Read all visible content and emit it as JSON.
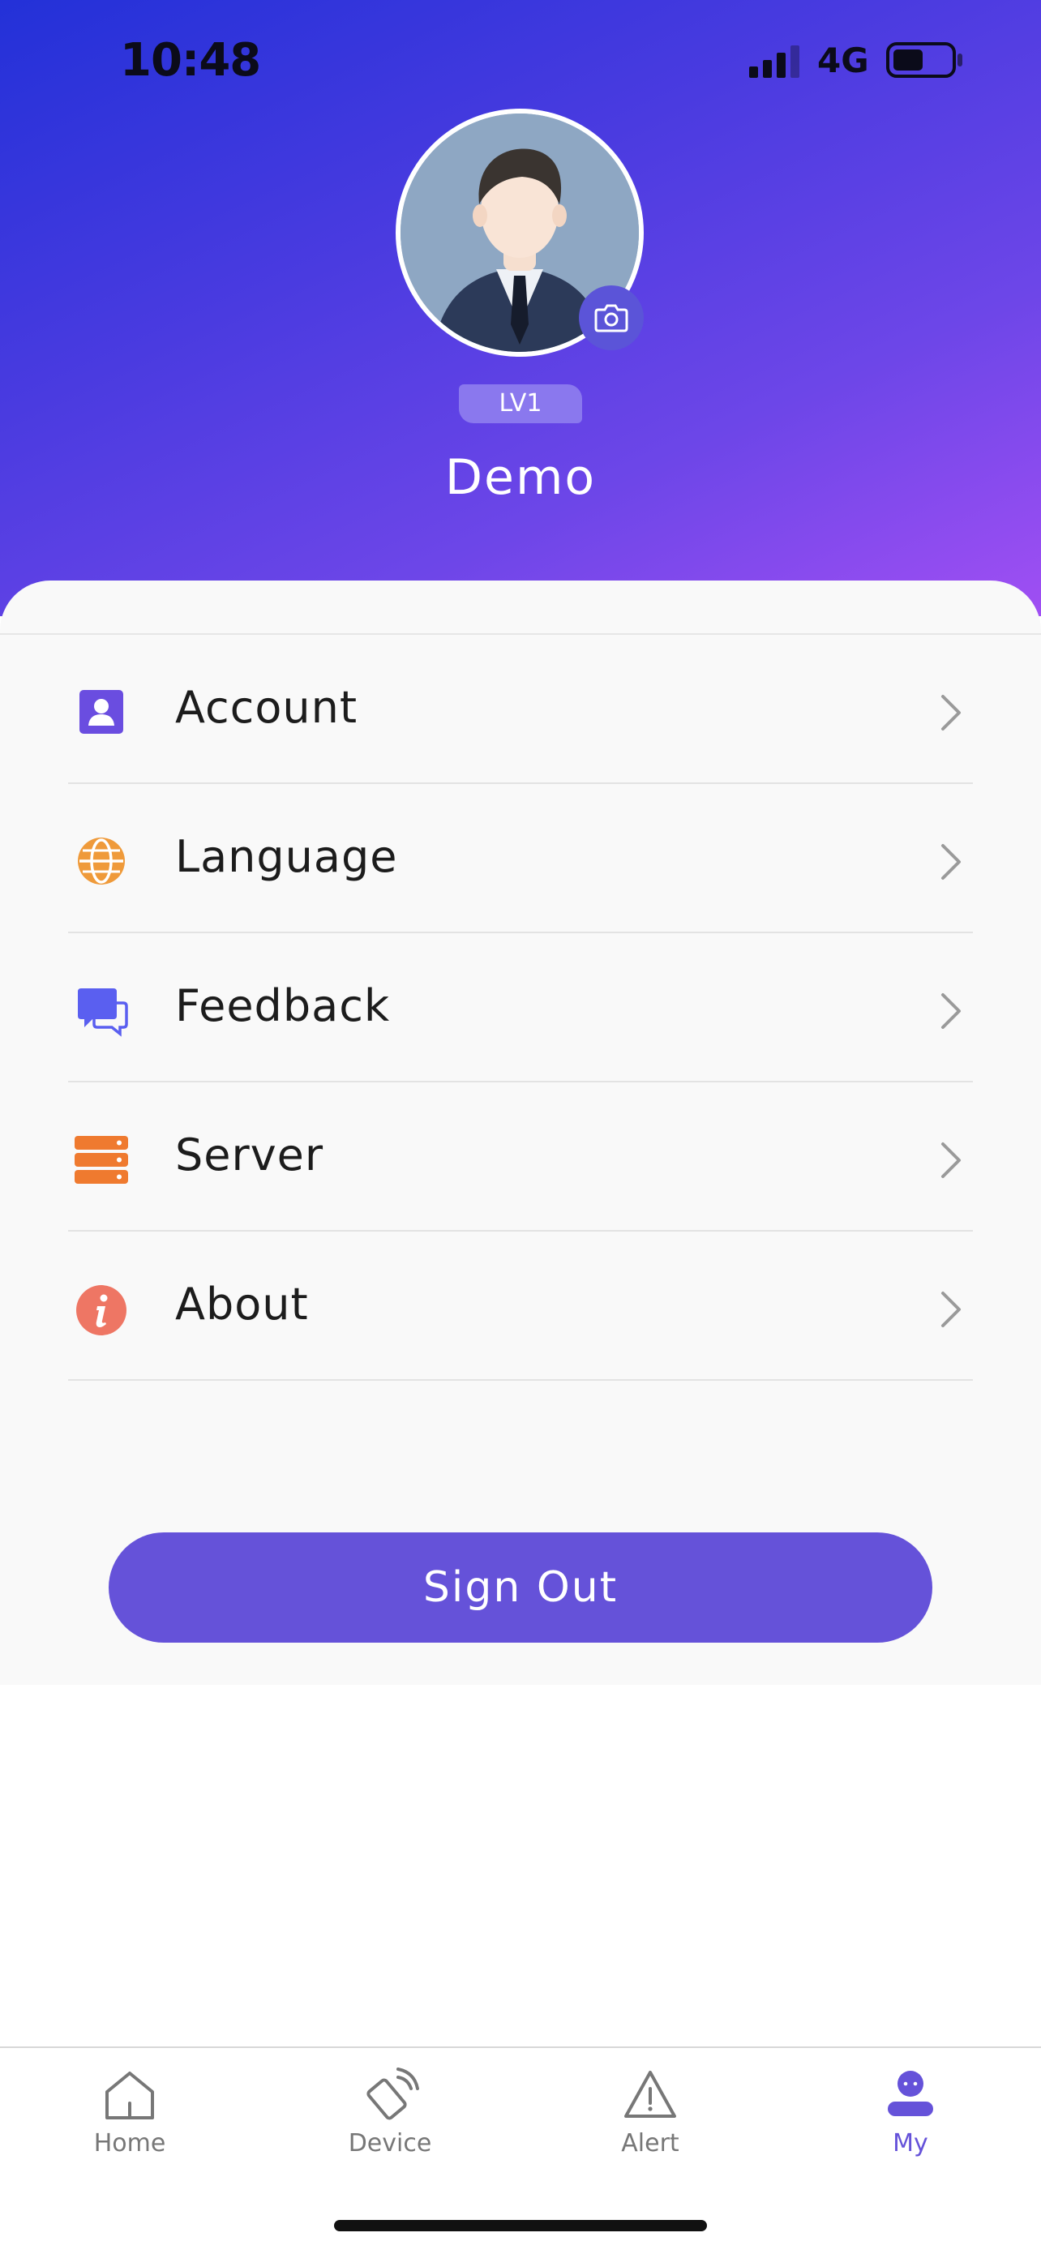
{
  "status_bar": {
    "time": "10:48",
    "network": "4G",
    "signal_icon": "signal-bars-icon",
    "battery_icon": "battery-icon"
  },
  "profile": {
    "level": "LV1",
    "name": "Demo",
    "avatar": "default-person-avatar",
    "camera_icon": "camera-icon"
  },
  "menu": {
    "items": [
      {
        "label": "Account",
        "icon": "account-icon",
        "color": "#6a4de0"
      },
      {
        "label": "Language",
        "icon": "globe-icon",
        "color": "#ef9a3a"
      },
      {
        "label": "Feedback",
        "icon": "chat-icon",
        "color": "#5a5ff0"
      },
      {
        "label": "Server",
        "icon": "server-icon",
        "color": "#ef7a2f"
      },
      {
        "label": "About",
        "icon": "info-icon",
        "color": "#ee7664"
      }
    ]
  },
  "actions": {
    "sign_out": "Sign Out"
  },
  "tab_bar": {
    "tabs": [
      {
        "label": "Home",
        "icon": "home-icon",
        "active": false
      },
      {
        "label": "Device",
        "icon": "device-icon",
        "active": false
      },
      {
        "label": "Alert",
        "icon": "alert-icon",
        "active": false
      },
      {
        "label": "My",
        "icon": "profile-icon",
        "active": true
      }
    ]
  },
  "colors": {
    "accent": "#6552d9",
    "header_gradient_start": "#2331d8",
    "header_gradient_end": "#a04ff3"
  }
}
